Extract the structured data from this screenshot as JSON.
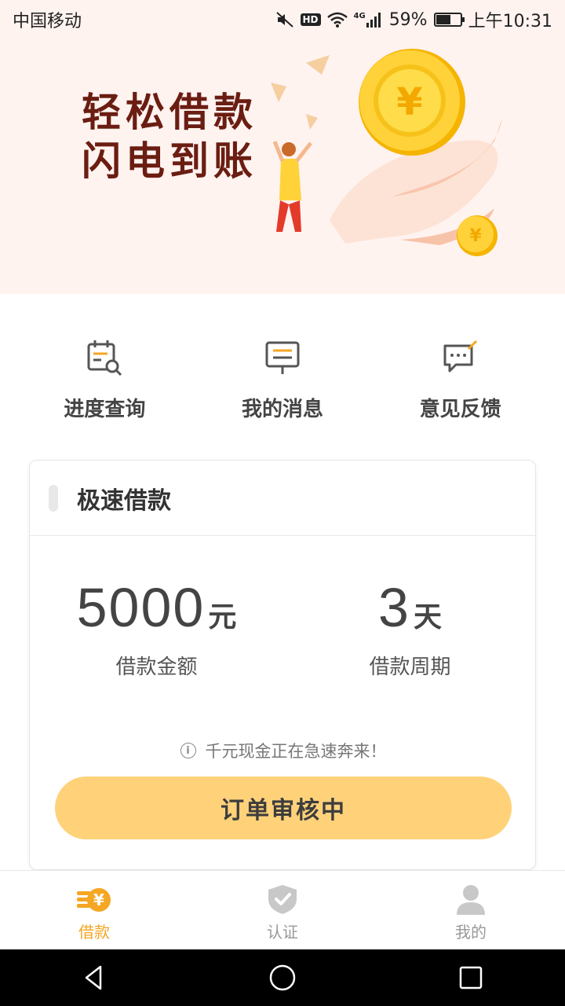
{
  "status_bar": {
    "carrier": "中国移动",
    "hd": "HD",
    "network": "4G",
    "battery": "59%",
    "time": "上午10:31"
  },
  "banner": {
    "line1": "轻松借款",
    "line2": "闪电到账"
  },
  "actions": [
    {
      "label": "进度查询",
      "icon": "calendar-search-icon"
    },
    {
      "label": "我的消息",
      "icon": "message-icon"
    },
    {
      "label": "意见反馈",
      "icon": "feedback-icon"
    }
  ],
  "card": {
    "title": "极速借款",
    "amount_value": "5000",
    "amount_unit": "元",
    "amount_label": "借款金额",
    "period_value": "3",
    "period_unit": "天",
    "period_label": "借款周期",
    "notice": "千元现金正在急速奔来！",
    "button": "订单审核中"
  },
  "tabs": [
    {
      "label": "借款",
      "icon": "yen-coins-icon",
      "active": true
    },
    {
      "label": "认证",
      "icon": "shield-check-icon",
      "active": false
    },
    {
      "label": "我的",
      "icon": "user-icon",
      "active": false
    }
  ],
  "colors": {
    "accent": "#f5a623",
    "button": "#ffd27a",
    "banner_bg": "#fff3f0",
    "slogan": "#6b1d12"
  }
}
